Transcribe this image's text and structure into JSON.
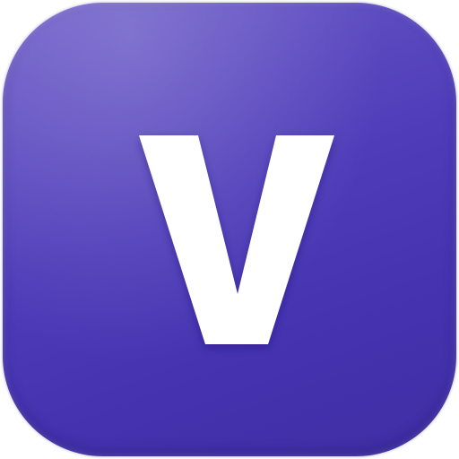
{
  "icon": {
    "letter": "V",
    "colors": {
      "background_top": "#6d5cc9",
      "background_bottom": "#3f2ea4",
      "letter": "#ffffff"
    }
  }
}
